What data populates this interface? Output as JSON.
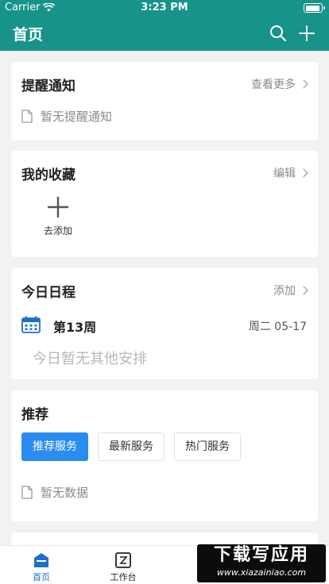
{
  "status_bar": {
    "carrier": "Carrier",
    "time": "3:23 PM"
  },
  "header": {
    "title": "首页"
  },
  "reminder": {
    "title": "提醒通知",
    "more": "查看更多",
    "empty": "暂无提醒通知"
  },
  "favorites": {
    "title": "我的收藏",
    "edit": "编辑",
    "add_label": "去添加"
  },
  "schedule": {
    "title": "今日日程",
    "add": "添加",
    "week": "第13周",
    "date": "周二 05-17",
    "empty": "今日暂无其他安排"
  },
  "recommend": {
    "title": "推荐",
    "tabs": [
      {
        "label": "推荐服务",
        "active": true
      },
      {
        "label": "最新服务",
        "active": false
      },
      {
        "label": "热门服务",
        "active": false
      }
    ],
    "empty": "暂无数据"
  },
  "tabbar": {
    "items": [
      {
        "label": "首页",
        "active": true
      },
      {
        "label": "工作台",
        "active": false
      }
    ]
  },
  "watermark": {
    "main": "下载写应用",
    "sub": "www.xiazainiao.com"
  },
  "colors": {
    "header_bg": "#17938a",
    "tab_active": "#2a8cf0",
    "tabbar_active": "#1f6fd1"
  }
}
